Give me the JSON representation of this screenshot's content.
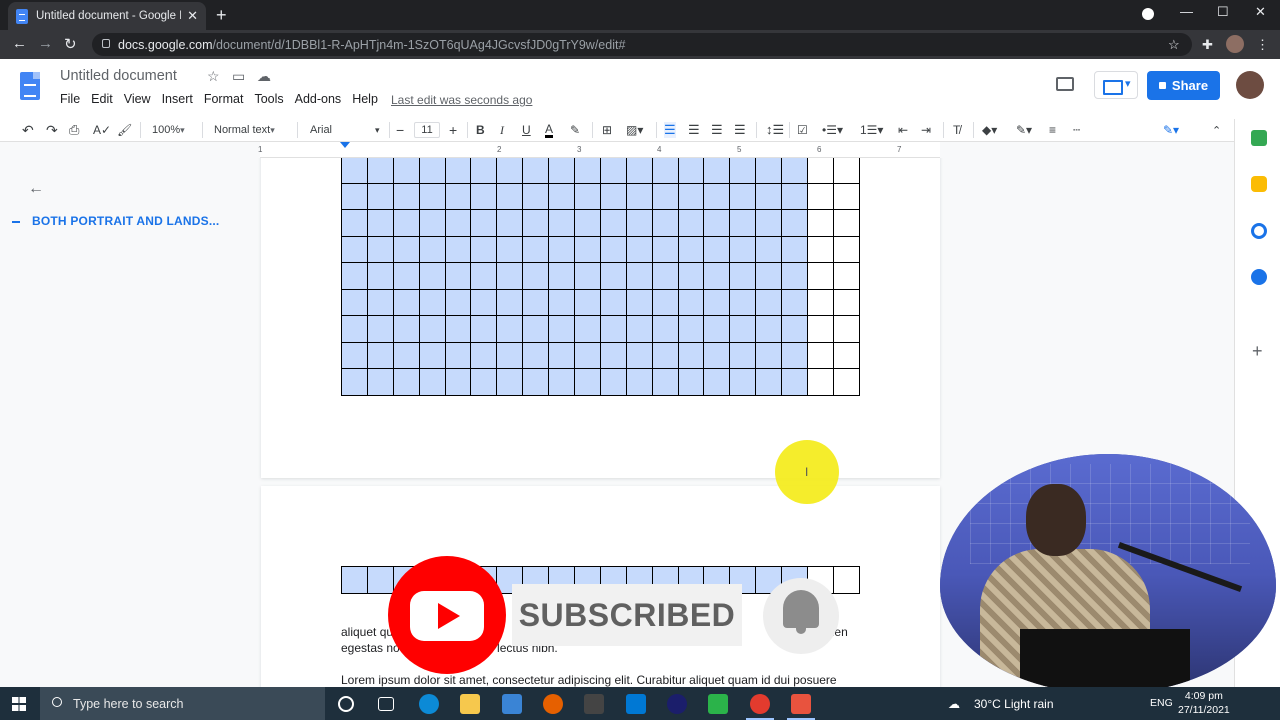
{
  "browser": {
    "tab_title": "Untitled document - Google Doc",
    "url_host": "docs.google.com",
    "url_path": "/document/d/1DBBl1-R-ApHTjn4m-1SzOT6qUAg4JGcvsfJD0gTrY9w/edit#"
  },
  "docs": {
    "title": "Untitled document",
    "menu": [
      "File",
      "Edit",
      "View",
      "Insert",
      "Format",
      "Tools",
      "Add-ons",
      "Help"
    ],
    "last_edit": "Last edit was seconds ago",
    "share_label": "Share",
    "toolbar": {
      "zoom": "100%",
      "style": "Normal text",
      "font": "Arial",
      "font_size": "11",
      "bold": "B",
      "italic": "I",
      "underline": "U",
      "text_color": "A"
    },
    "ruler_numbers": [
      "1",
      "2",
      "3",
      "4",
      "5",
      "6",
      "7"
    ]
  },
  "outline": {
    "heading": "BOTH PORTRAIT AND LANDS..."
  },
  "document": {
    "partial_line_1a": "aliquet qu",
    "partial_line_1b": "al",
    "partial_line_1c": "ellen",
    "partial_line_2a": "egestas no",
    "partial_line_2b": "r lectus nibh.",
    "paragraph": "Lorem ipsum dolor sit amet, consectetur adipiscing elit. Curabitur aliquet quam id dui posuere"
  },
  "overlay": {
    "subscribed_label": "SUBSCRIBED"
  },
  "taskbar": {
    "search_placeholder": "Type here to search",
    "weather": "30°C  Light rain",
    "language": "ENG",
    "time": "4:09 pm",
    "date": "27/11/2021"
  },
  "colors": {
    "accent": "#1a73e8",
    "selection": "#c6dafc",
    "youtube_red": "#ff0000"
  }
}
